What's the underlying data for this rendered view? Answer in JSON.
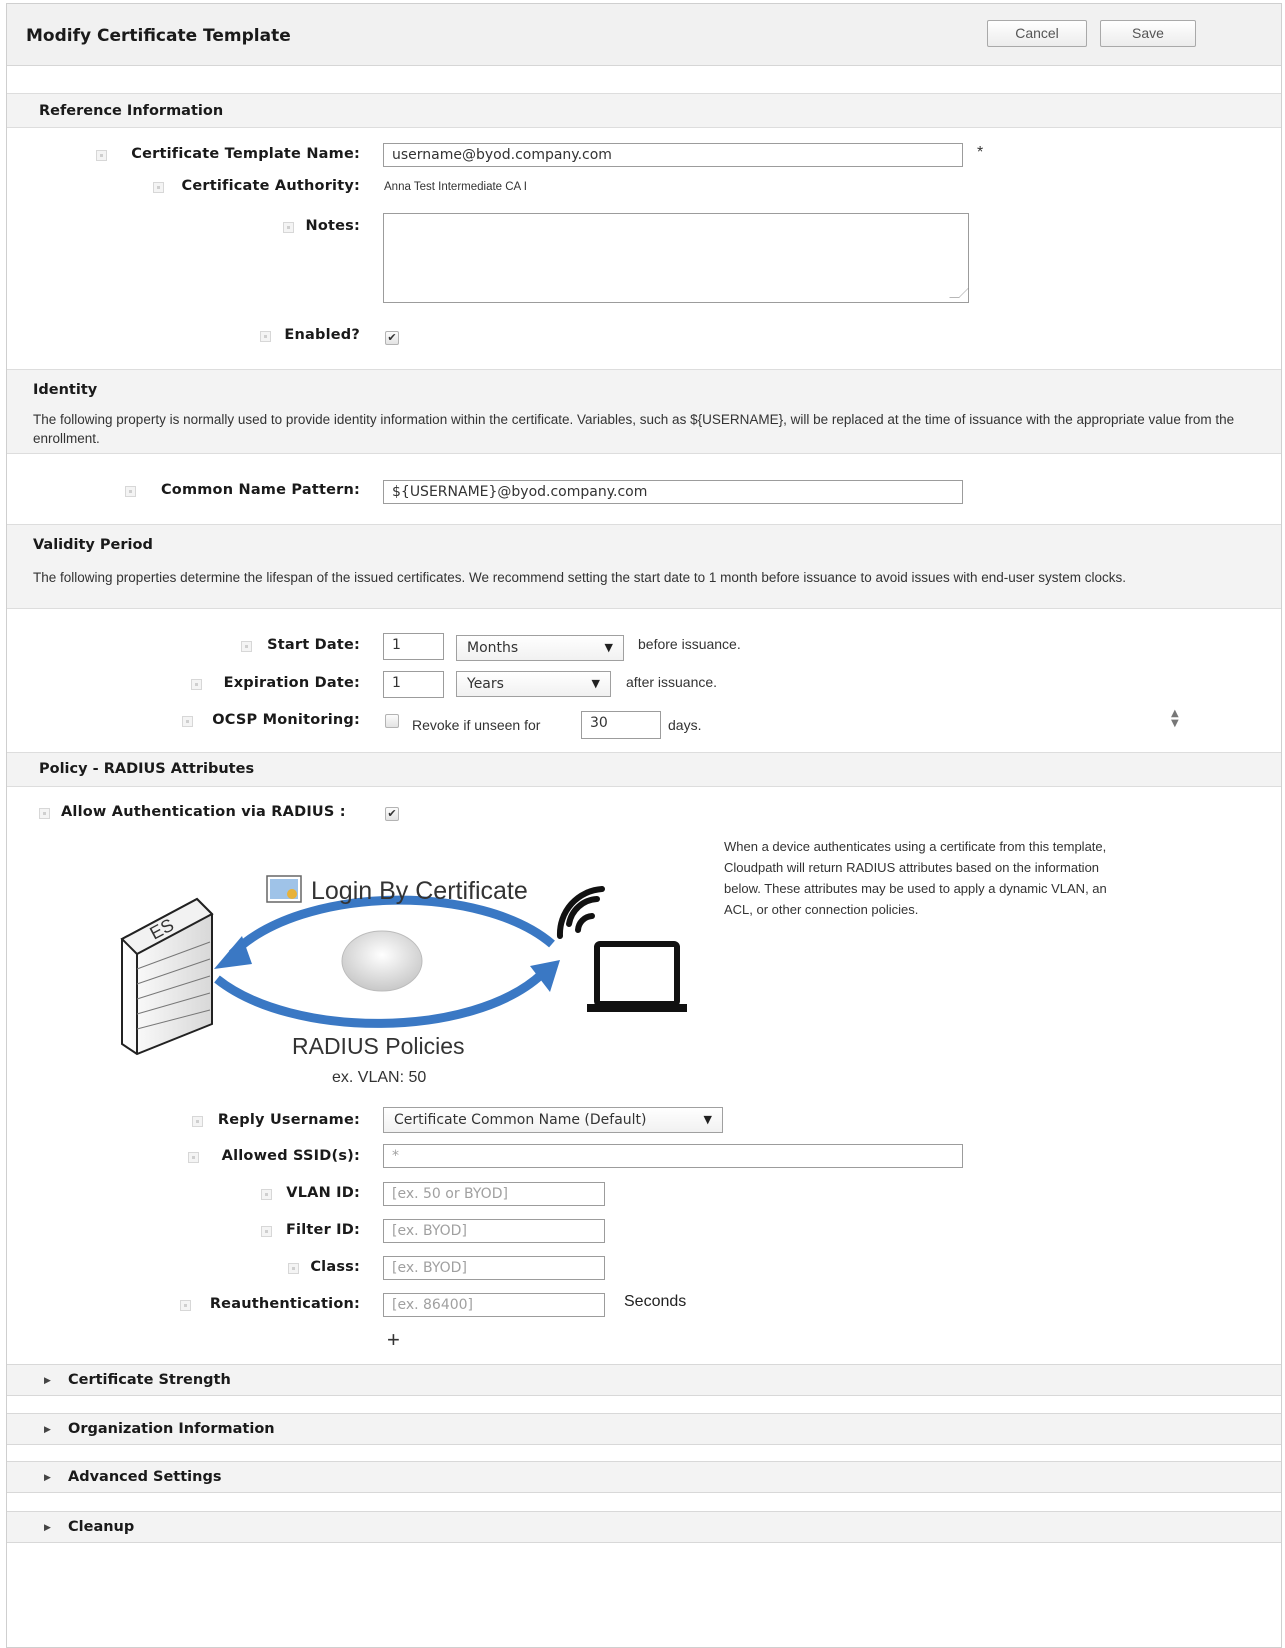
{
  "header": {
    "title": "Modify Certificate Template",
    "cancel_label": "Cancel",
    "save_label": "Save"
  },
  "reference": {
    "heading": "Reference Information",
    "template_name_label": "Certificate Template Name:",
    "template_name_value": "username@byod.company.com",
    "required_mark": "*",
    "authority_label": "Certificate Authority:",
    "authority_value": "Anna Test Intermediate CA I",
    "notes_label": "Notes:",
    "notes_value": "",
    "enabled_label": "Enabled?",
    "enabled_checked": true
  },
  "identity": {
    "heading": "Identity",
    "description": "The following property is normally used to provide identity information within the certificate. Variables, such as ${USERNAME}, will be replaced at the time of issuance with the appropriate value from the enrollment.",
    "cn_label": "Common Name Pattern:",
    "cn_value": "${USERNAME}@byod.company.com"
  },
  "validity": {
    "heading": "Validity Period",
    "description": "The following properties determine the lifespan of the issued certificates. We recommend setting the start date to 1 month before issuance to avoid issues with end-user system clocks.",
    "start_label": "Start Date:",
    "start_value": "1",
    "start_unit": "Months",
    "start_suffix": "before issuance.",
    "expiration_label": "Expiration Date:",
    "expiration_value": "1",
    "expiration_unit": "Years",
    "expiration_suffix": "after issuance.",
    "ocsp_label": "OCSP Monitoring:",
    "ocsp_text": "Revoke if unseen for",
    "ocsp_days_value": "30",
    "ocsp_days_suffix": "days."
  },
  "radius": {
    "heading": "Policy - RADIUS Attributes",
    "allow_label": "Allow Authentication via RADIUS :",
    "allow_checked": true,
    "info_text": "When a device authenticates using a certificate from this template, Cloudpath will return RADIUS attributes based on the information below. These attributes may be used to apply a dynamic VLAN, an ACL, or other connection policies.",
    "diagram": {
      "login_text": "Login By Certificate",
      "server_label": "ES",
      "policies_text": "RADIUS Policies",
      "example_text": "ex. VLAN: 50"
    },
    "reply_username_label": "Reply Username:",
    "reply_username_value": "Certificate Common Name (Default)",
    "ssid_label": "Allowed SSID(s):",
    "ssid_placeholder": "*",
    "vlan_label": "VLAN ID:",
    "vlan_placeholder": "[ex. 50 or BYOD]",
    "filter_label": "Filter ID:",
    "filter_placeholder": "[ex. BYOD]",
    "class_label": "Class:",
    "class_placeholder": "[ex. BYOD]",
    "reauth_label": "Reauthentication:",
    "reauth_placeholder": "[ex. 86400]",
    "reauth_unit": "Seconds",
    "add_symbol": "+"
  },
  "collapsed_sections": [
    {
      "label": "Certificate Strength"
    },
    {
      "label": "Organization Information"
    },
    {
      "label": "Advanced Settings"
    },
    {
      "label": "Cleanup"
    }
  ]
}
